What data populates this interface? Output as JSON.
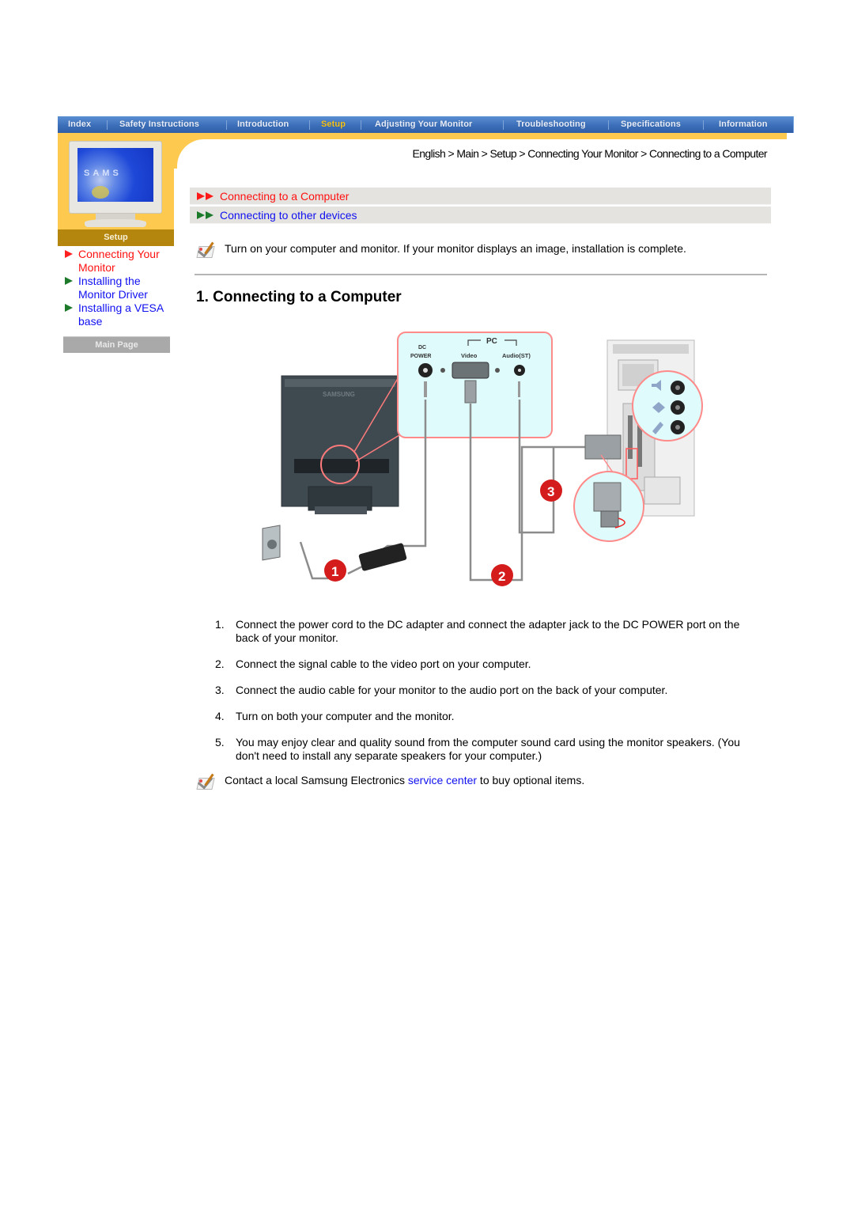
{
  "topnav": {
    "tabs": [
      {
        "label": "Index",
        "active": false
      },
      {
        "label": "Safety Instructions",
        "active": false
      },
      {
        "label": "Introduction",
        "active": false
      },
      {
        "label": "Setup",
        "active": true
      },
      {
        "label": "Adjusting Your Monitor",
        "active": false
      },
      {
        "label": "Troubleshooting",
        "active": false
      },
      {
        "label": "Specifications",
        "active": false
      },
      {
        "label": "Information",
        "active": false
      }
    ]
  },
  "sidebar": {
    "monitor_logo": "SAMS",
    "section_label": "Setup",
    "links": [
      {
        "label": "Connecting Your Monitor",
        "active": true
      },
      {
        "label": "Installing the Monitor Driver",
        "active": false
      },
      {
        "label": "Installing a VESA base",
        "active": false
      }
    ],
    "main_page_button": "Main Page"
  },
  "breadcrumb": {
    "items": [
      "English",
      "Main",
      "Setup",
      "Connecting Your Monitor",
      "Connecting to a Computer"
    ],
    "separator": ">"
  },
  "subnav": {
    "items": [
      {
        "label": "Connecting to a Computer",
        "active": true
      },
      {
        "label": "Connecting to other devices",
        "active": false
      }
    ]
  },
  "note_top": "Turn on your computer and monitor. If your monitor displays an image, installation is complete.",
  "section_title": "1. Connecting to a Computer",
  "diagram": {
    "brand_label": "SAMSUNG",
    "pc_label": "PC",
    "port_dc_line1": "DC",
    "port_dc_line2": "POWER",
    "port_video": "Video",
    "port_audio": "Audio(ST)",
    "badges": [
      "1",
      "2",
      "3"
    ]
  },
  "steps": [
    {
      "num": "1.",
      "text": "Connect the power cord to the DC adapter and connect the adapter jack to the DC POWER port on the back of your monitor."
    },
    {
      "num": "2.",
      "text": "Connect the signal cable to the video port on your computer."
    },
    {
      "num": "3.",
      "text": "Connect the audio cable for your monitor to the audio port on the back of your computer."
    },
    {
      "num": "4.",
      "text": "Turn on both your computer and the monitor."
    },
    {
      "num": "5.",
      "text": "You may enjoy clear and quality sound from the computer sound card using the monitor speakers. (You don't need to install any separate speakers for your computer.)"
    }
  ],
  "note_bottom": {
    "before": "Contact a local Samsung Electronics ",
    "link": "service center",
    "after": " to buy optional items."
  },
  "colors": {
    "nav_blue": "#3c6fb9",
    "nav_active": "#f4c21a",
    "orange": "#fdc94f",
    "setup_bar": "#b5860e",
    "link_blue": "#1010f0",
    "link_red": "#ff1010",
    "arrow_green": "#1d7a2b"
  }
}
